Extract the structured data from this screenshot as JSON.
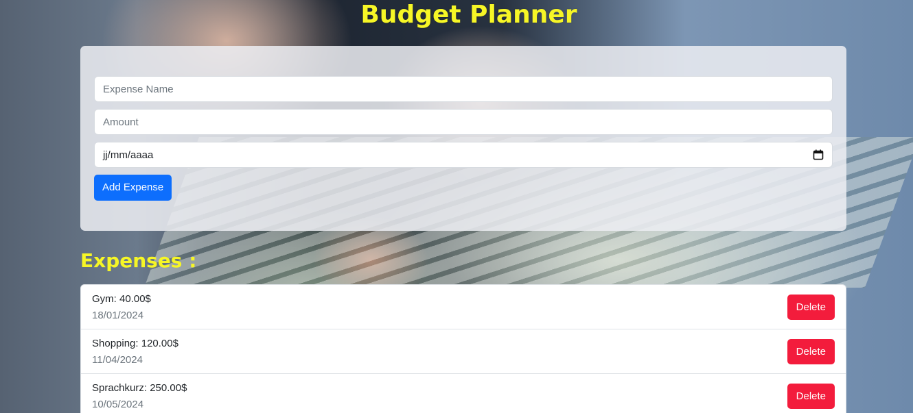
{
  "app": {
    "title": "Budget Planner"
  },
  "form": {
    "name_placeholder": "Expense Name",
    "amount_placeholder": "Amount",
    "date_placeholder": "jj/mm/aaaa",
    "add_label": "Add Expense",
    "date_icon": "calendar-icon"
  },
  "expenses": {
    "heading": "Expenses :",
    "delete_label": "Delete",
    "items": [
      {
        "label": "Gym: 40.00$",
        "date": "18/01/2024"
      },
      {
        "label": "Shopping: 120.00$",
        "date": "11/04/2024"
      },
      {
        "label": "Sprachkurz: 250.00$",
        "date": "10/05/2024"
      }
    ]
  },
  "colors": {
    "heading": "#f6f626",
    "primary": "#0d6efd",
    "danger": "#f31c3c"
  }
}
